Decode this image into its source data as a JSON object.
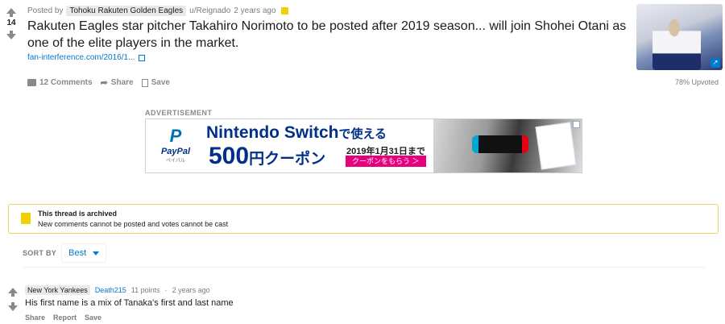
{
  "post": {
    "score": "14",
    "posted_by_prefix": "Posted by",
    "flair": "Tohoku Rakuten Golden Eagles",
    "author": "u/Reignado",
    "time": "2 years ago",
    "title": "Rakuten Eagles star pitcher Takahiro Norimoto to be posted after 2019 season... will join Shohei Otani as one of the elite players in the market.",
    "link_text": "fan-interference.com/2016/1...",
    "actions": {
      "comments": "12 Comments",
      "share": "Share",
      "save": "Save"
    },
    "upvoted": "78% Upvoted"
  },
  "ad": {
    "label": "ADVERTISEMENT",
    "paypal_p": "P",
    "paypal_name": "PayPal",
    "paypal_sub": "ペイパル",
    "headline": "Nintendo Switch",
    "headline_jp": "で使える",
    "amount": "500",
    "amount_jp": "円クーポン",
    "deadline": "2019年1月31日まで",
    "cta": "クーポンをもらう ＞"
  },
  "archived": {
    "title": "This thread is archived",
    "subtitle": "New comments cannot be posted and votes cannot be cast"
  },
  "sort": {
    "label": "SORT BY",
    "value": "Best"
  },
  "comment": {
    "flair": "New York Yankees",
    "author": "Death215",
    "points": "11 points",
    "separator": "·",
    "time": "2 years ago",
    "body": "His first name is a mix of Tanaka's first and last name",
    "actions": {
      "share": "Share",
      "report": "Report",
      "save": "Save"
    }
  },
  "colors": {
    "link": "#0079d3",
    "archived_border": "#e8d36c",
    "gold": "#f0d000"
  }
}
